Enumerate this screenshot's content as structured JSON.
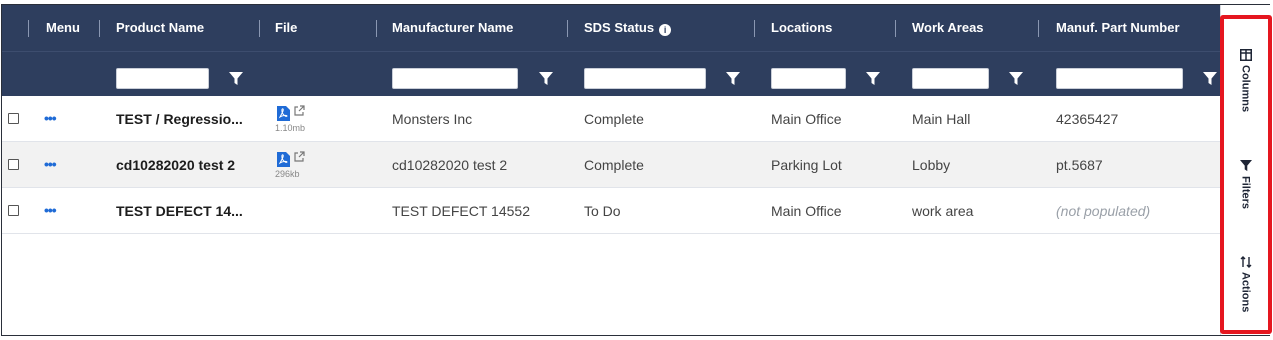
{
  "columns": {
    "menu": "Menu",
    "product_name": "Product Name",
    "file": "File",
    "manufacturer_name": "Manufacturer Name",
    "sds_status": "SDS Status",
    "locations": "Locations",
    "work_areas": "Work Areas",
    "manuf_part_number": "Manuf. Part Number"
  },
  "rows": [
    {
      "product_name": "TEST / Regressio...",
      "file_size": "1.10mb",
      "manufacturer": "Monsters Inc",
      "sds_status": "Complete",
      "location": "Main Office",
      "work_area": "Main Hall",
      "part_number": "42365427"
    },
    {
      "product_name": "cd10282020 test 2",
      "file_size": "296kb",
      "manufacturer": "cd10282020 test 2",
      "sds_status": "Complete",
      "location": "Parking Lot",
      "work_area": "Lobby",
      "part_number": "pt.5687"
    },
    {
      "product_name": "TEST DEFECT 14...",
      "file_size": "",
      "manufacturer": "TEST DEFECT 14552",
      "sds_status": "To Do",
      "location": "Main Office",
      "work_area": "work area",
      "part_number": "(not populated)"
    }
  ],
  "menu_glyph": "•••",
  "info_glyph": "i",
  "sidebar": {
    "columns_label": "Columns",
    "filters_label": "Filters",
    "actions_label": "Actions"
  },
  "colors": {
    "header_bg": "#2e3e5e",
    "accent": "#1f6bd6",
    "highlight": "#e5161f"
  },
  "icons": [
    "filter-icon",
    "pdf-icon",
    "external-link-icon",
    "columns-icon",
    "sort-actions-icon",
    "info-icon"
  ]
}
